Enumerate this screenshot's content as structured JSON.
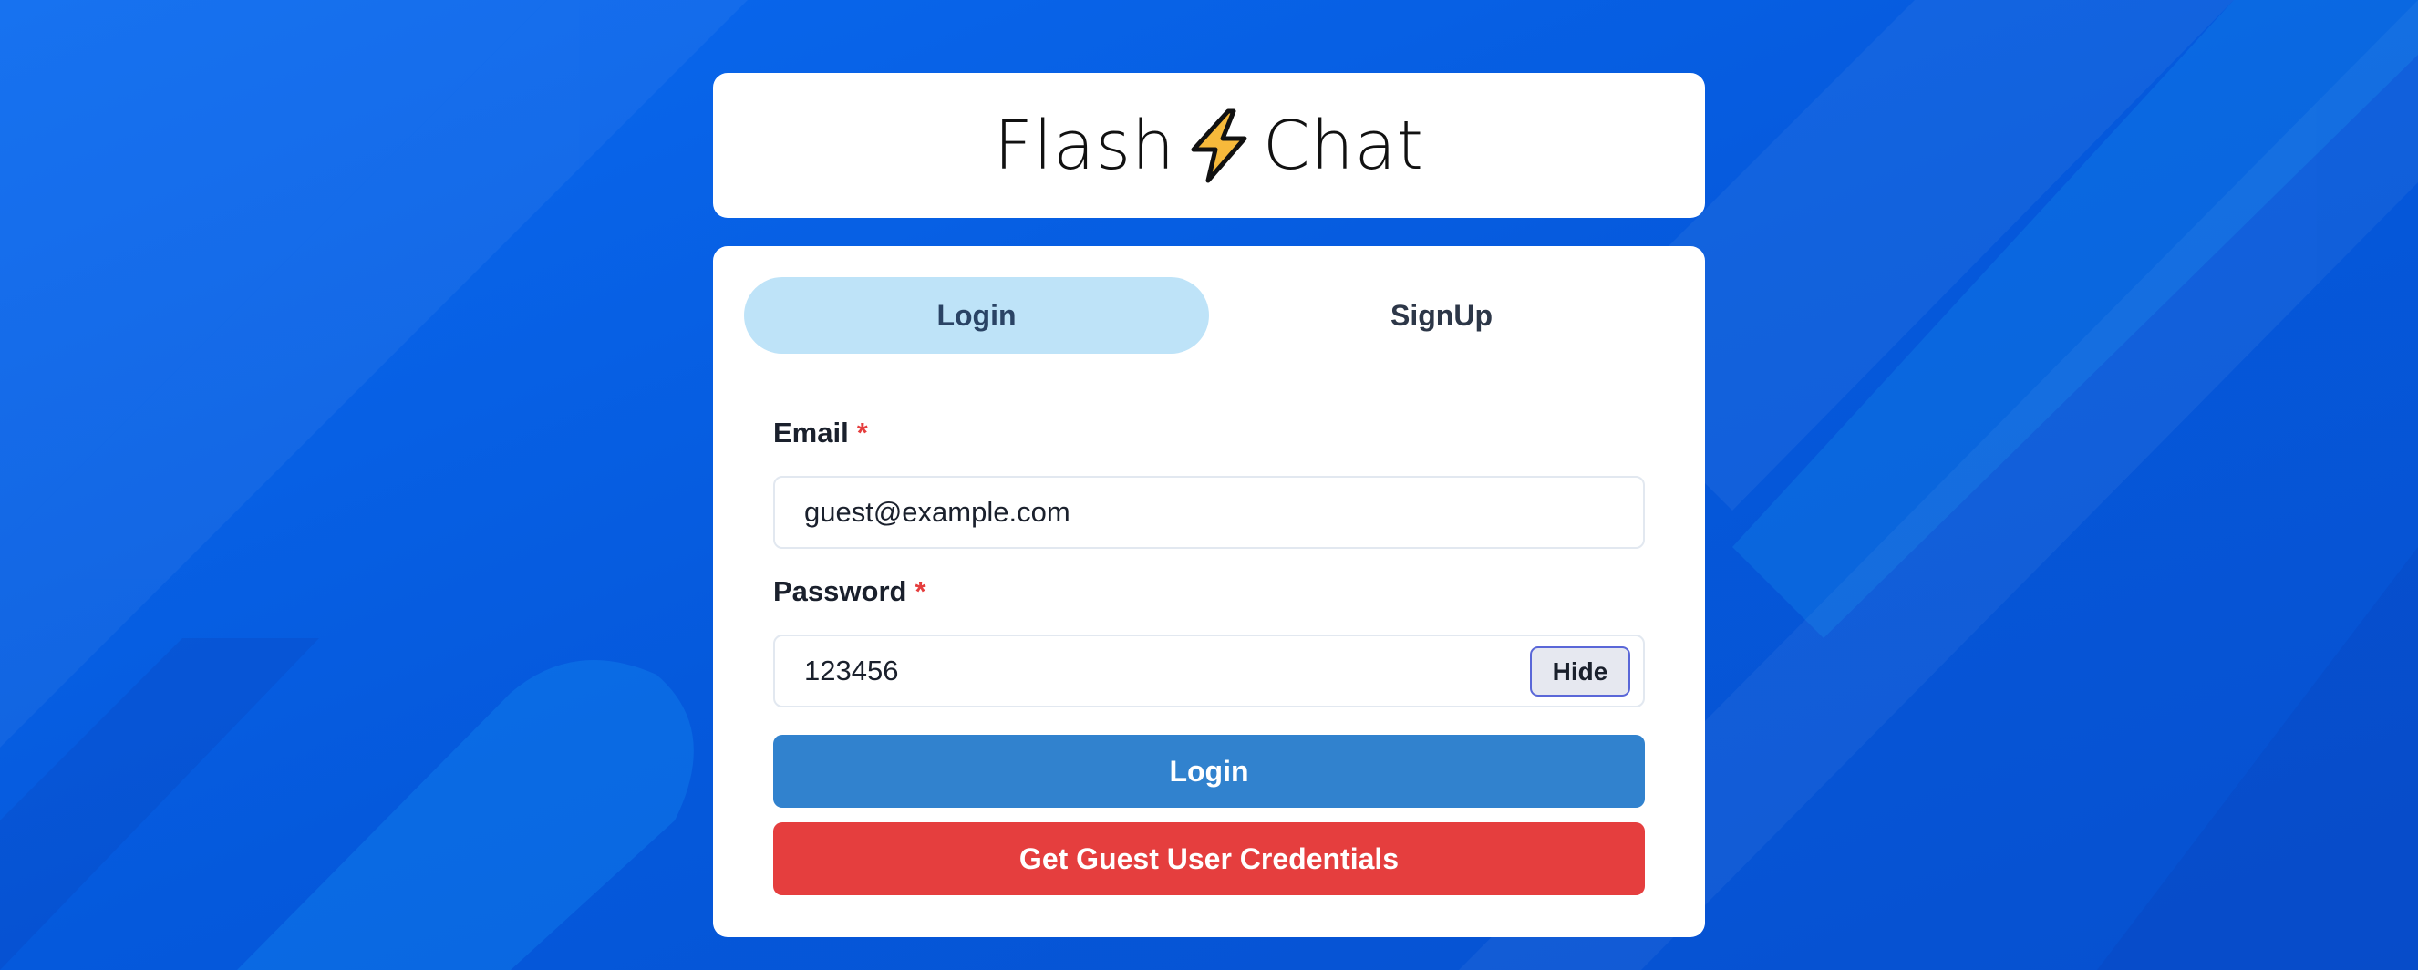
{
  "brand": {
    "name_left": "Flash",
    "name_right": "Chat",
    "icon": "lightning-bolt-icon"
  },
  "tabs": [
    {
      "label": "Login",
      "active": true
    },
    {
      "label": "SignUp",
      "active": false
    }
  ],
  "form": {
    "email_label": "Email",
    "email_required": "*",
    "email_value": "guest@example.com",
    "password_label": "Password",
    "password_required": "*",
    "password_value": "123456",
    "hide_label": "Hide",
    "login_button": "Login",
    "guest_button": "Get Guest User Credentials"
  },
  "colors": {
    "background": "#0a5fe0",
    "active_tab": "#bee3f8",
    "login_button": "#3182ce",
    "guest_button": "#e53e3e",
    "required_mark": "#e53e3e",
    "bolt": "#f6b93b"
  }
}
